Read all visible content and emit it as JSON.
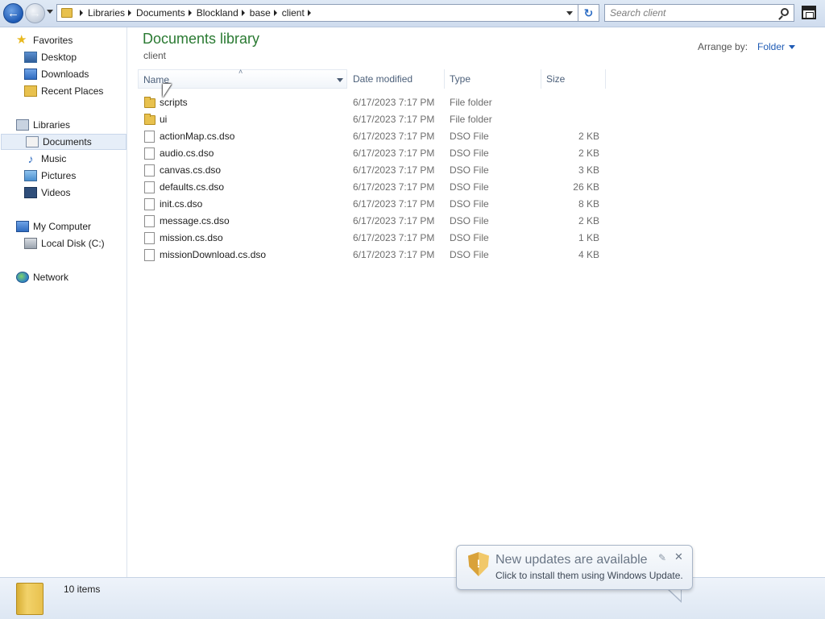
{
  "address": {
    "crumbs": [
      "Libraries",
      "Documents",
      "Blockland",
      "base",
      "client"
    ]
  },
  "search": {
    "placeholder": "Search client"
  },
  "sidebar": {
    "favorites": "Favorites",
    "fav_items": [
      "Desktop",
      "Downloads",
      "Recent Places"
    ],
    "libraries": "Libraries",
    "lib_items": [
      "Documents",
      "Music",
      "Pictures",
      "Videos"
    ],
    "computer": "My Computer",
    "computer_items": [
      "Local Disk (C:)"
    ],
    "network": "Network",
    "selected": "Documents"
  },
  "main": {
    "title": "Documents library",
    "subtitle": "client",
    "arrange_label": "Arrange by:",
    "arrange_value": "Folder",
    "columns": [
      "Name",
      "Date modified",
      "Type",
      "Size"
    ],
    "files": [
      {
        "name": "scripts",
        "date": "6/17/2023 7:17 PM",
        "type": "File folder",
        "size": "",
        "kind": "folder"
      },
      {
        "name": "ui",
        "date": "6/17/2023 7:17 PM",
        "type": "File folder",
        "size": "",
        "kind": "folder"
      },
      {
        "name": "actionMap.cs.dso",
        "date": "6/17/2023 7:17 PM",
        "type": "DSO File",
        "size": "2 KB",
        "kind": "file"
      },
      {
        "name": "audio.cs.dso",
        "date": "6/17/2023 7:17 PM",
        "type": "DSO File",
        "size": "2 KB",
        "kind": "file"
      },
      {
        "name": "canvas.cs.dso",
        "date": "6/17/2023 7:17 PM",
        "type": "DSO File",
        "size": "3 KB",
        "kind": "file"
      },
      {
        "name": "defaults.cs.dso",
        "date": "6/17/2023 7:17 PM",
        "type": "DSO File",
        "size": "26 KB",
        "kind": "file"
      },
      {
        "name": "init.cs.dso",
        "date": "6/17/2023 7:17 PM",
        "type": "DSO File",
        "size": "8 KB",
        "kind": "file"
      },
      {
        "name": "message.cs.dso",
        "date": "6/17/2023 7:17 PM",
        "type": "DSO File",
        "size": "2 KB",
        "kind": "file"
      },
      {
        "name": "mission.cs.dso",
        "date": "6/17/2023 7:17 PM",
        "type": "DSO File",
        "size": "1 KB",
        "kind": "file"
      },
      {
        "name": "missionDownload.cs.dso",
        "date": "6/17/2023 7:17 PM",
        "type": "DSO File",
        "size": "4 KB",
        "kind": "file"
      }
    ]
  },
  "status": {
    "count": "10 items"
  },
  "notification": {
    "title": "New updates are available",
    "text": "Click to install them using Windows Update."
  },
  "colors": {
    "title_green": "#2a7a32",
    "link_blue": "#1f5bb5",
    "folder_yellow": "#e8c14e"
  }
}
